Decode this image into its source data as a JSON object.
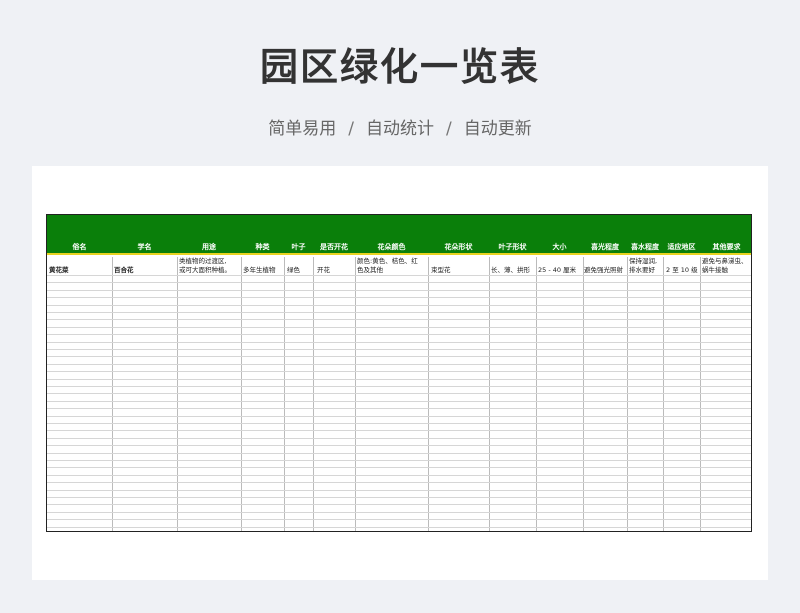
{
  "page": {
    "title": "园区绿化一览表",
    "subtitle_parts": [
      "简单易用",
      "自动统计",
      "自动更新"
    ],
    "separator": "/"
  },
  "colors": {
    "header_green": "#0a7f0a",
    "header_underline": "#e8d320",
    "background": "#eff1f5"
  },
  "table": {
    "columns": [
      "俗名",
      "学名",
      "用途",
      "种类",
      "叶子",
      "是否开花",
      "花朵颜色",
      "花朵形状",
      "叶子形状",
      "大小",
      "喜光程度",
      "喜水程度",
      "适应地区",
      "其他要求"
    ],
    "rows": [
      {
        "common_name": "黄花菜",
        "scientific_name": "百合花",
        "usage_line1": "类植物的过渡区,",
        "usage_line2": "或可大面积种植。",
        "type": "多年生植物",
        "leaf": "绿色",
        "flowering": "开花",
        "flower_color_line1": "颜色:黄色、桔色、红",
        "flower_color_line2": "色及其他",
        "flower_shape": "束型花",
        "leaf_shape": "长、薄、拱形",
        "size": "25 - 40 厘米",
        "light": "避免强光照射",
        "water_line1": "保持湿润,",
        "water_line2": "排水要好",
        "region": "2 至 10 级",
        "other_line1": "避免与鼻涕虫、",
        "other_line2": "蜗牛接触"
      }
    ]
  }
}
